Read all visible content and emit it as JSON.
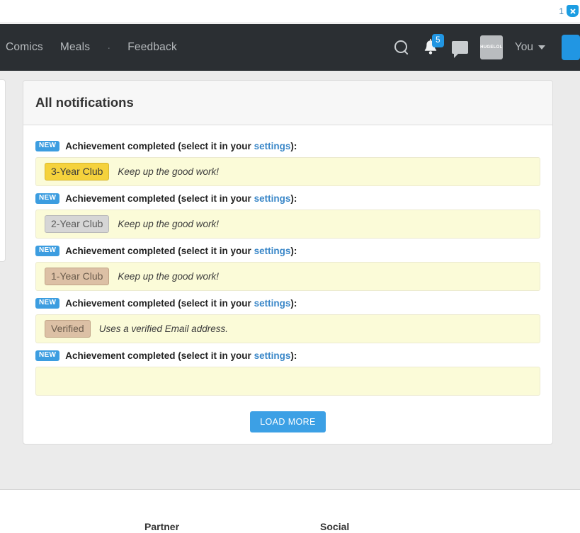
{
  "browser_strip": {
    "count": "1",
    "shield_icon": "shield-block-icon"
  },
  "navbar": {
    "links": [
      {
        "label": "Comics"
      },
      {
        "label": "Meals"
      }
    ],
    "separator": "·",
    "feedback_label": "Feedback",
    "search_icon": "search-icon",
    "bell_icon": "bell-icon",
    "bell_count": "5",
    "chat_icon": "chat-bubble-icon",
    "avatar_text": "HUGELOL",
    "user_label": "You",
    "caret_icon": "chevron-down-icon",
    "accent_color": "#2196e3",
    "bar_color": "#2b2f33"
  },
  "notifications": {
    "title": "All notifications",
    "rows": [
      {
        "new_label": "NEW",
        "text_before": "Achievement completed (select it in your ",
        "link_label": "settings",
        "text_after": "):",
        "badge_label": "3-Year Club",
        "badge_tier": "gold",
        "description": "Keep up the good work!"
      },
      {
        "new_label": "NEW",
        "text_before": "Achievement completed (select it in your ",
        "link_label": "settings",
        "text_after": "):",
        "badge_label": "2-Year Club",
        "badge_tier": "silver",
        "description": "Keep up the good work!"
      },
      {
        "new_label": "NEW",
        "text_before": "Achievement completed (select it in your ",
        "link_label": "settings",
        "text_after": "):",
        "badge_label": "1-Year Club",
        "badge_tier": "bronze",
        "description": "Keep up the good work!"
      },
      {
        "new_label": "NEW",
        "text_before": "Achievement completed (select it in your ",
        "link_label": "settings",
        "text_after": "):",
        "badge_label": "Verified",
        "badge_tier": "bronze",
        "description": "Uses a verified Email address."
      },
      {
        "new_label": "NEW",
        "text_before": "Achievement completed (select it in your ",
        "link_label": "settings",
        "text_after": "):",
        "badge_label": "",
        "badge_tier": "none",
        "description": ""
      }
    ],
    "load_more_label": "LOAD MORE",
    "panel_color": "#fbfbd8",
    "link_color": "#3a87c8"
  },
  "footer": {
    "partner_label": "Partner",
    "social_label": "Social"
  }
}
